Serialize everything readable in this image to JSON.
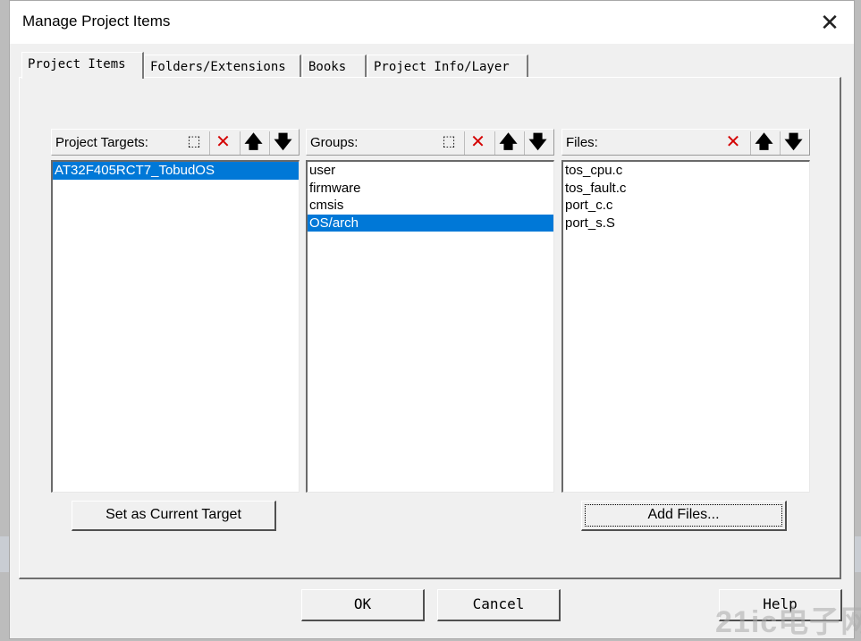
{
  "dialog": {
    "title": "Manage Project Items",
    "close_glyph": "✕"
  },
  "tabs": [
    {
      "label": "Project Items",
      "active": true
    },
    {
      "label": "Folders/Extensions",
      "active": false
    },
    {
      "label": "Books",
      "active": false
    },
    {
      "label": "Project Info/Layer",
      "active": false
    }
  ],
  "targets": {
    "label": "Project Targets:",
    "items": [
      "AT32F405RCT7_TobudOS"
    ],
    "selected": "AT32F405RCT7_TobudOS",
    "icons": [
      "new-item-icon",
      "delete-icon",
      "move-up-icon",
      "move-down-icon"
    ]
  },
  "groups": {
    "label": "Groups:",
    "items": [
      "user",
      "firmware",
      "cmsis",
      "OS/arch"
    ],
    "selected": "OS/arch",
    "icons": [
      "new-item-icon",
      "delete-icon",
      "move-up-icon",
      "move-down-icon"
    ]
  },
  "files": {
    "label": "Files:",
    "items": [
      "tos_cpu.c",
      "tos_fault.c",
      "port_c.c",
      "port_s.S"
    ],
    "icons": [
      "delete-icon",
      "move-up-icon",
      "move-down-icon"
    ]
  },
  "buttons": {
    "set_target": "Set as Current Target",
    "add_files": "Add Files...",
    "ok": "OK",
    "cancel": "Cancel",
    "help": "Help"
  },
  "glyphs": {
    "new": "⬚",
    "delete": "✕",
    "up": "🡅",
    "down": "🡇"
  },
  "watermark": "21ic电子网",
  "colors": {
    "selection": "#0078d7",
    "delete_icon": "#d40000"
  }
}
